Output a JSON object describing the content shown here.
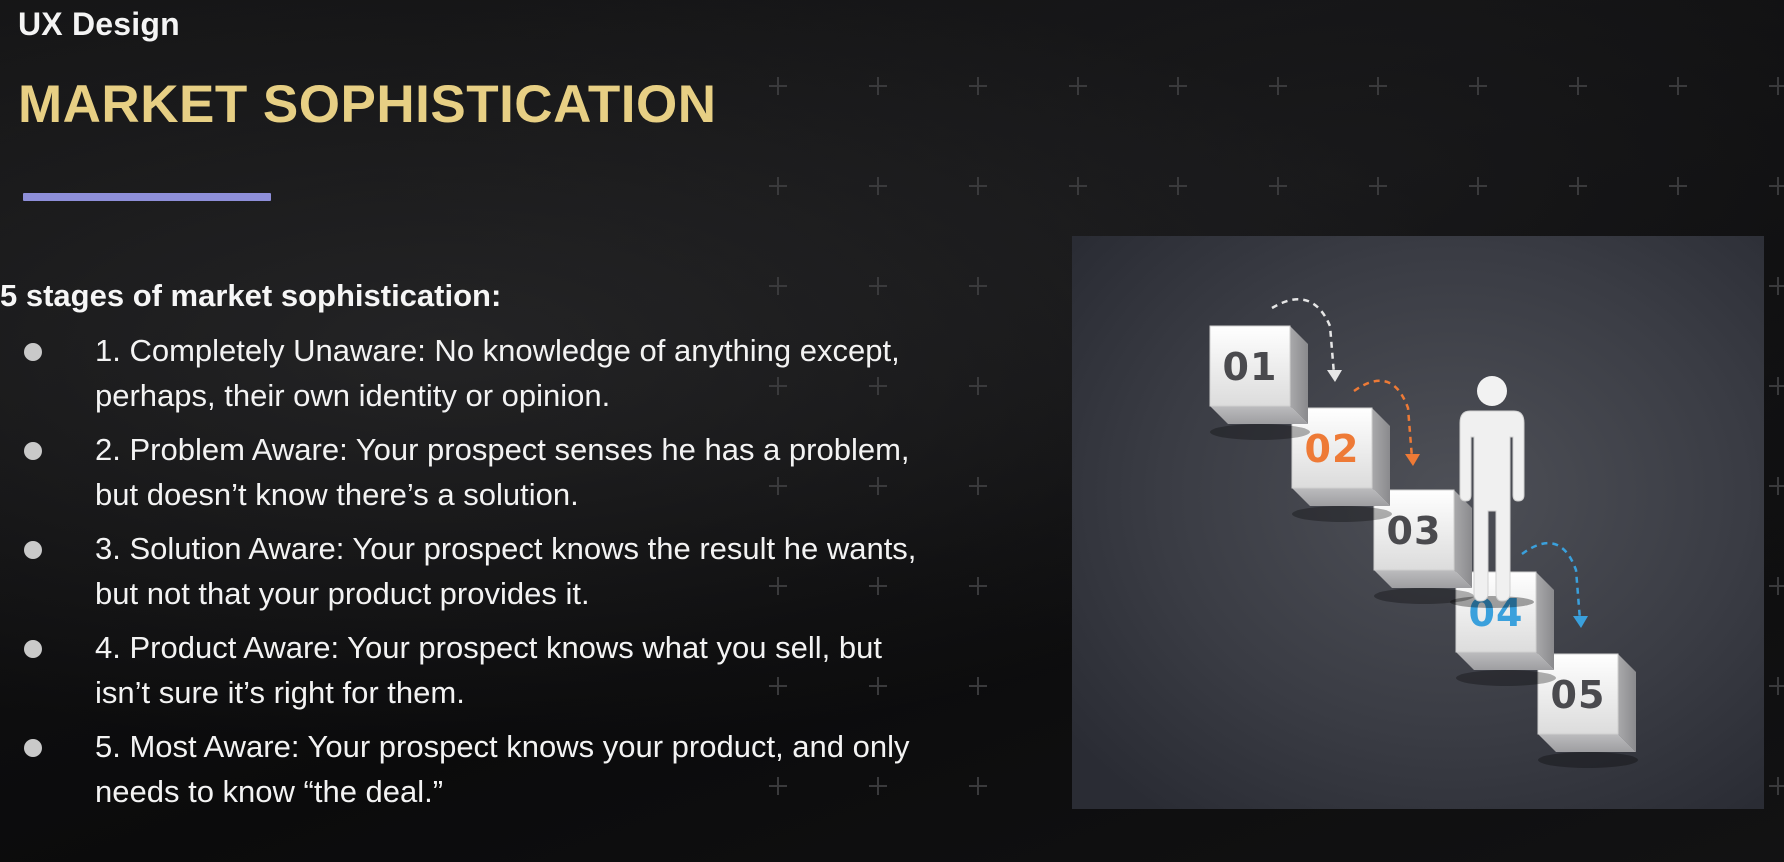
{
  "slide": {
    "course_label": "UX Design",
    "title": "MARKET SOPHISTICATION",
    "intro": "5 stages of market sophistication:",
    "stages": [
      {
        "line1": "1. Completely Unaware: No knowledge of anything except,",
        "line2": "perhaps, their own identity or opinion."
      },
      {
        "line1": "2. Problem Aware: Your prospect senses he has a problem,",
        "line2": "but doesn’t know there’s a solution."
      },
      {
        "line1": "3. Solution Aware: Your prospect knows the result he wants,",
        "line2": "but not that your product provides it."
      },
      {
        "line1": "4. Product Aware: Your prospect knows what you sell, but",
        "line2": "isn’t sure it’s right for them."
      },
      {
        "line1": "5. Most Aware: Your prospect knows your product, and only",
        "line2": "needs to know “the deal.”"
      }
    ]
  },
  "figure": {
    "step_labels": [
      "01",
      "02",
      "03",
      "04",
      "05"
    ],
    "step_colors": [
      "#4a4a4e",
      "#ee7a36",
      "#4a4a4e",
      "#3aa0dc",
      "#4a4a4e"
    ],
    "icons": [
      "person-icon",
      "dashed-arrow-icon"
    ]
  },
  "colors": {
    "title": "#e7cf84",
    "underline": "#8e8fd9"
  }
}
